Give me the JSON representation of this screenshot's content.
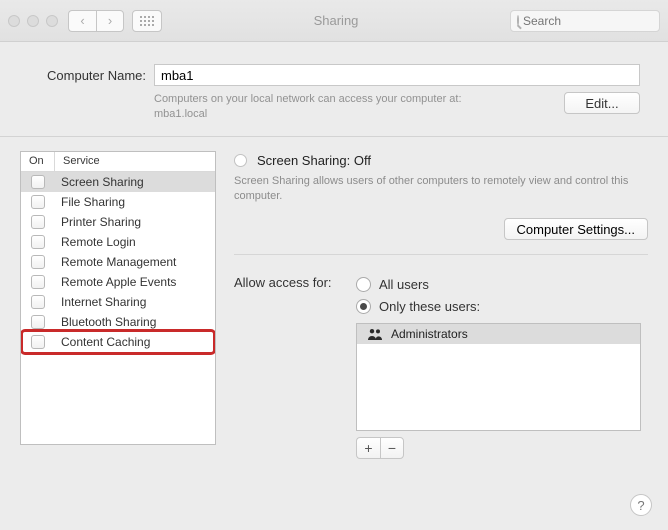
{
  "window": {
    "title": "Sharing",
    "search_placeholder": "Search"
  },
  "computer_name": {
    "label": "Computer Name:",
    "value": "mba1",
    "note_line1": "Computers on your local network can access your computer at:",
    "note_line2": "mba1.local",
    "edit_label": "Edit..."
  },
  "services": {
    "header_on": "On",
    "header_service": "Service",
    "items": [
      {
        "label": "Screen Sharing",
        "on": false,
        "selected": true,
        "highlight": false
      },
      {
        "label": "File Sharing",
        "on": false,
        "selected": false,
        "highlight": false
      },
      {
        "label": "Printer Sharing",
        "on": false,
        "selected": false,
        "highlight": false
      },
      {
        "label": "Remote Login",
        "on": false,
        "selected": false,
        "highlight": false
      },
      {
        "label": "Remote Management",
        "on": false,
        "selected": false,
        "highlight": false
      },
      {
        "label": "Remote Apple Events",
        "on": false,
        "selected": false,
        "highlight": false
      },
      {
        "label": "Internet Sharing",
        "on": false,
        "selected": false,
        "highlight": false
      },
      {
        "label": "Bluetooth Sharing",
        "on": false,
        "selected": false,
        "highlight": false
      },
      {
        "label": "Content Caching",
        "on": false,
        "selected": false,
        "highlight": true
      }
    ]
  },
  "detail": {
    "status": "Screen Sharing: Off",
    "description": "Screen Sharing allows users of other computers to remotely view and control this computer.",
    "settings_button": "Computer Settings...",
    "access_label": "Allow access for:",
    "access_options": {
      "all": "All users",
      "only": "Only these users:",
      "selected": "only"
    },
    "users": [
      "Administrators"
    ],
    "plus": "+",
    "minus": "−"
  },
  "help": "?"
}
